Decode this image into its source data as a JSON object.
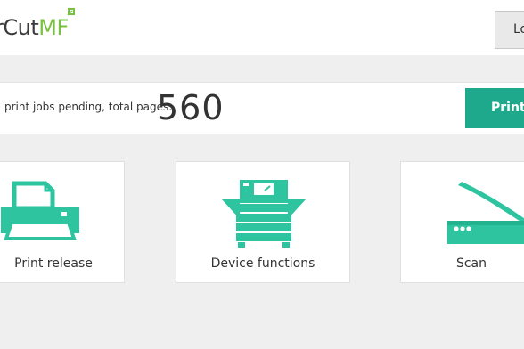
{
  "header": {
    "logo": {
      "main": "rCut",
      "accent": "MF"
    },
    "logout_label": "Lo"
  },
  "pending": {
    "label": "print jobs pending, total pages:",
    "total_pages": "560",
    "print_all_label": "Print A"
  },
  "tiles": [
    {
      "label": "Print release",
      "icon": "printer-icon"
    },
    {
      "label": "Device functions",
      "icon": "multifunction-device-icon"
    },
    {
      "label": "Scan",
      "icon": "scanner-icon"
    }
  ],
  "colors": {
    "accent": "#1fa98c",
    "icon": "#2ec4a0",
    "logo_green": "#7ac143",
    "background": "#efefef"
  }
}
